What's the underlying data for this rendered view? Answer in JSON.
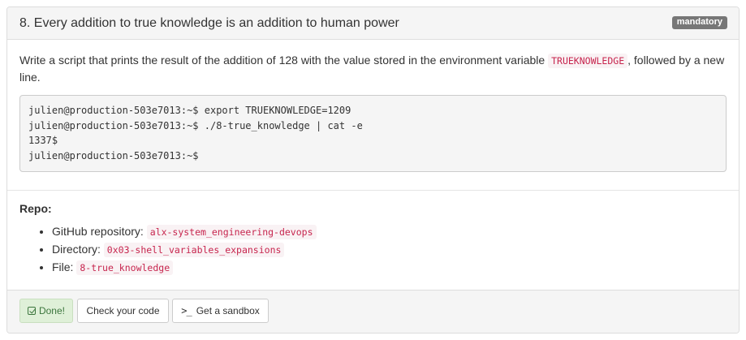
{
  "task": {
    "title": "8. Every addition to true knowledge is an addition to human power",
    "badge": "mandatory",
    "description_before": "Write a script that prints the result of the addition of 128 with the value stored in the environment variable ",
    "description_code": "TRUEKNOWLEDGE",
    "description_after": ", followed by a new line.",
    "terminal_lines": [
      "julien@production-503e7013:~$ export TRUEKNOWLEDGE=1209",
      "julien@production-503e7013:~$ ./8-true_knowledge | cat -e",
      "1337$",
      "julien@production-503e7013:~$"
    ]
  },
  "repo": {
    "title": "Repo:",
    "items": [
      {
        "label": "GitHub repository: ",
        "value": "alx-system_engineering-devops"
      },
      {
        "label": "Directory: ",
        "value": "0x03-shell_variables_expansions"
      },
      {
        "label": "File: ",
        "value": "8-true_knowledge"
      }
    ]
  },
  "footer": {
    "done_label": "Done!",
    "check_label": "Check your code",
    "sandbox_icon": ">_",
    "sandbox_label": "Get a sandbox"
  },
  "icons": {
    "done": "check-square-icon",
    "sandbox": "terminal-icon"
  },
  "colors": {
    "badge_bg": "#777777",
    "code_text": "#c7254e",
    "code_bg": "#f9f2f4",
    "done_bg": "#dff0d8",
    "done_text": "#3c763d"
  }
}
